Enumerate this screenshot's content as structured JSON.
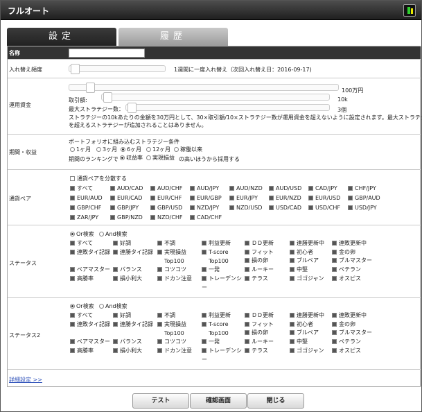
{
  "window": {
    "title": "フルオート"
  },
  "tabs": [
    {
      "label": "設定"
    },
    {
      "label": "履歴"
    }
  ],
  "name_row": {
    "label": "名称",
    "value": ""
  },
  "rebalance": {
    "label": "入れ替え頻度",
    "text": "1週間に一度入れ替え（次回入れ替え日：2016-09-17)"
  },
  "funds": {
    "label": "運用資金",
    "amount_text": "100万円",
    "lot_label": "取引額:",
    "lot_value": "10k",
    "max_label": "最大ストラテジー数：",
    "max_value": "3個",
    "note1": "ストラテジーの10kあたりの金額を30万円として、30×取引額/10×ストラテジー数が運用資金を超えないように設定されます。最大ストラテジー数",
    "note2": "を超えるストラテジーが追加されることはありません。"
  },
  "period": {
    "label": "期間・収益",
    "cond_title": "ポートフォリオに組み込むストラテジー条件",
    "options": [
      "1ヶ月",
      "3ヶ月",
      "6ヶ月",
      "12ヶ月",
      "稼働以来"
    ],
    "selected_index": 2,
    "rank_prefix": "期間のランキングで",
    "rank_options": [
      "収益率",
      "実現損益"
    ],
    "rank_selected_index": 0,
    "rank_suffix": "の高いほうから採用する"
  },
  "pairs": {
    "label": "通貨ペア",
    "diversify_label": "通貨ペアを分散する",
    "items": [
      "すべて",
      "AUD/CAD",
      "AUD/CHF",
      "AUD/JPY",
      "AUD/NZD",
      "AUD/USD",
      "CAD/JPY",
      "CHF/JPY",
      "EUR/AUD",
      "EUR/CAD",
      "EUR/CHF",
      "EUR/GBP",
      "EUR/JPY",
      "EUR/NZD",
      "EUR/USD",
      "GBP/AUD",
      "GBP/CHF",
      "GBP/JPY",
      "GBP/USD",
      "NZD/JPY",
      "NZD/USD",
      "USD/CAD",
      "USD/CHF",
      "USD/JPY",
      "ZAR/JPY",
      "GBP/NZD",
      "NZD/CHF",
      "CAD/CHF"
    ]
  },
  "status1": {
    "label": "ステータス",
    "or_label": "Or検索",
    "and_label": "And検索",
    "row1": [
      "すべて",
      "好調",
      "不調",
      "利益更新",
      "ＤＤ更新",
      "連勝更新中",
      "連敗更新中"
    ],
    "row2": [
      "連敗タイ記録",
      "連勝タイ記録",
      "実現損益",
      "T-score",
      "フィット",
      "初心者",
      "金の卵"
    ],
    "row2b": [
      "Top100",
      "Top100",
      "損の卵",
      "ブルベア",
      "ブルマスター"
    ],
    "row3": [
      "ベアマスター",
      "バランス",
      "コツコツ",
      "一発",
      "ルーキー",
      "中堅",
      "ベテラン"
    ],
    "row4": [
      "高勝率",
      "損小利大",
      "ドカン注意",
      "トレーデンシ",
      "テラス",
      "ゴゴジャン",
      "オスピス"
    ],
    "wrap": "ー"
  },
  "status2": {
    "label": "ステータス2",
    "or_label": "Or検索",
    "and_label": "And検索",
    "row1": [
      "すべて",
      "好調",
      "不調",
      "利益更新",
      "ＤＤ更新",
      "連勝更新中",
      "連敗更新中"
    ],
    "row2": [
      "連敗タイ記録",
      "連勝タイ記録",
      "実現損益",
      "T-score",
      "フィット",
      "初心者",
      "金の卵"
    ],
    "row2b": [
      "Top100",
      "Top100",
      "損の卵",
      "ブルベア",
      "ブルマスター"
    ],
    "row3": [
      "ベアマスター",
      "バランス",
      "コツコツ",
      "一発",
      "ルーキー",
      "中堅",
      "ベテラン"
    ],
    "row4": [
      "高勝率",
      "損小利大",
      "ドカン注意",
      "トレーデンシ",
      "テラス",
      "ゴゴジャン",
      "オスピス"
    ],
    "wrap": "ー"
  },
  "detail_link": "詳細設定 >>",
  "buttons": {
    "test": "テスト",
    "confirm": "確認画面",
    "close": "閉じる"
  }
}
